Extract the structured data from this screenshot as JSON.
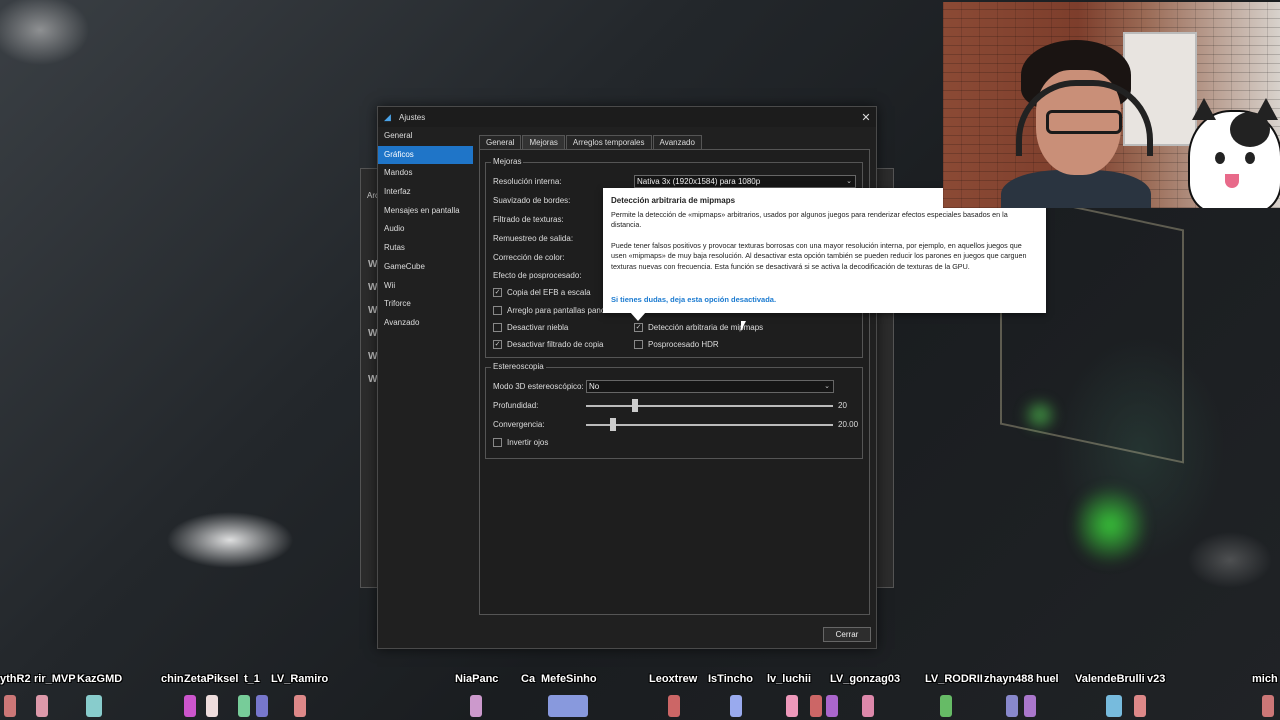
{
  "dialog": {
    "title": "Ajustes",
    "close_glyph": "✕",
    "sidebar": [
      "General",
      "Gráficos",
      "Mandos",
      "Interfaz",
      "Mensajes en pantalla",
      "Audio",
      "Rutas",
      "GameCube",
      "Wii",
      "Triforce",
      "Avanzado"
    ],
    "active_sidebar": "Gráficos",
    "tabs": [
      "General",
      "Mejoras",
      "Arreglos temporales",
      "Avanzado"
    ],
    "active_tab": "Mejoras",
    "enhancements": {
      "legend": "Mejoras",
      "labels": {
        "resolution": "Resolución interna:",
        "antialias": "Suavizado de bordes:",
        "texture_filter": "Filtrado de texturas:",
        "output_resample": "Remuestreo de salida:",
        "color_correction": "Corrección de color:",
        "post_effect": "Efecto de posprocesado:"
      },
      "resolution_value": "Nativa 3x (1920x1584) para 1080p",
      "checkboxes": {
        "efb_scale": {
          "label": "Copia del EFB a escala",
          "checked": true
        },
        "widescreen": {
          "label": "Arreglo para pantallas pano",
          "checked": false
        },
        "fog": {
          "label": "Desactivar niebla",
          "checked": false
        },
        "copy_filter": {
          "label": "Desactivar filtrado de copia",
          "checked": true
        },
        "mipmap": {
          "label": "Detección arbitraria de mipmaps",
          "checked": true
        },
        "hdr": {
          "label": "Posprocesado HDR",
          "checked": false
        }
      }
    },
    "stereo": {
      "legend": "Estereoscopia",
      "mode_label": "Modo 3D estereoscópico:",
      "mode_value": "No",
      "depth_label": "Profundidad:",
      "depth_value": "20",
      "depth_fraction": 0.2,
      "convergence_label": "Convergencia:",
      "convergence_value": "20.00",
      "convergence_fraction": 0.11,
      "invert": {
        "label": "Invertir ojos",
        "checked": false
      }
    },
    "close_button": "Cerrar"
  },
  "tooltip": {
    "title": "Detección arbitraria de mipmaps",
    "p1": "Permite la detección de «mipmaps» arbitrarios, usados por algunos juegos para renderizar efectos especiales basados en la distancia.",
    "p2": "Puede tener falsos positivos y provocar texturas borrosas con una mayor resolución interna, por ejemplo, en aquellos juegos que usen «mipmaps» de muy baja resolución. Al desactivar esta opción también se pueden reducir los parones en juegos que carguen texturas nuevas con frecuencia. Esta función se desactivará si se activa la decodificación de texturas de la GPU.",
    "note": "Si tienes dudas, deja esta opción desactivada."
  },
  "background_window": {
    "title_fragment": "Arc",
    "icons": [
      "W",
      "W",
      "W",
      "W",
      "W",
      "W"
    ]
  },
  "viewers": [
    "ythR2",
    "rir_MVP",
    "KazGMD",
    "chin",
    "ZetaPiksel",
    "t_1",
    "LV_Ramiro",
    "NiaPanc",
    "Ca",
    "MefeSinho",
    "Leoxtrew",
    "IsTincho",
    "lv_luchii",
    "LV_gonzag03",
    "LV_RODRII",
    "zhayn488",
    "huel",
    "ValendeBrulli",
    "v23",
    "mich"
  ],
  "colors": {
    "accent": "#1f75c8",
    "tooltip_note": "#1a7ad0"
  }
}
